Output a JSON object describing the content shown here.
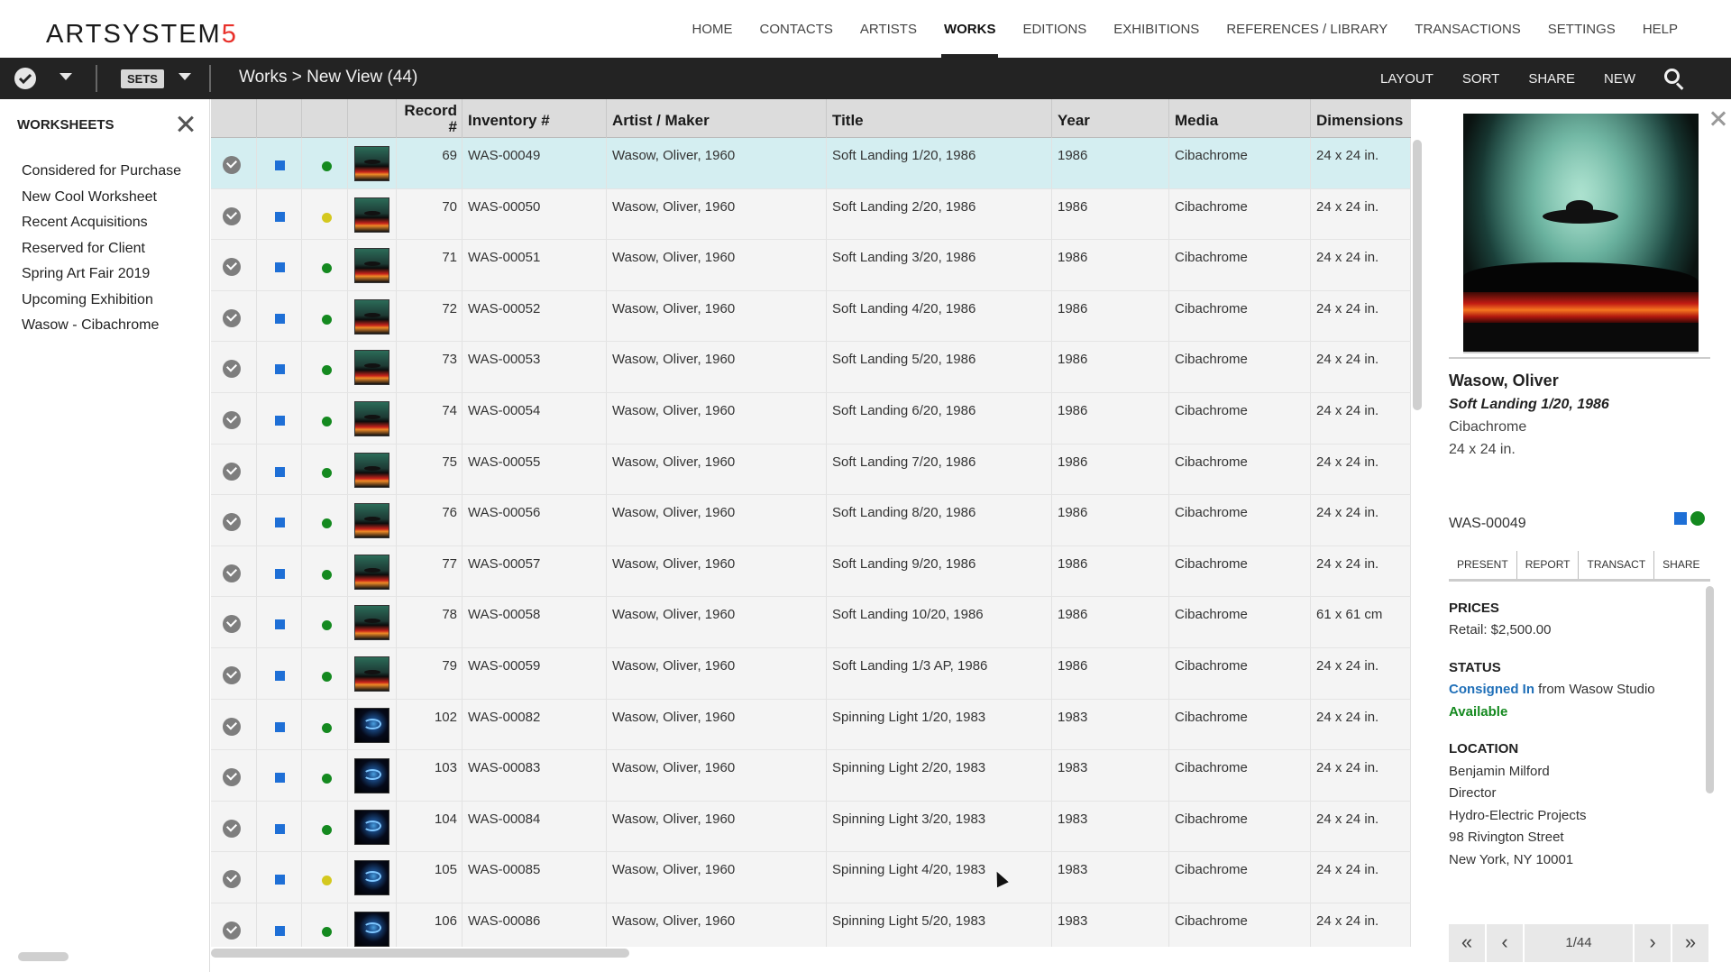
{
  "app": {
    "logo_main": "ARTSYSTEM",
    "logo_accent": "5"
  },
  "nav": [
    "HOME",
    "CONTACTS",
    "ARTISTS",
    "WORKS",
    "EDITIONS",
    "EXHIBITIONS",
    "REFERENCES / LIBRARY",
    "TRANSACTIONS",
    "SETTINGS",
    "HELP"
  ],
  "nav_active": "WORKS",
  "toolbar": {
    "sets_label": "SETS",
    "breadcrumb": "Works > New View (44)",
    "actions": [
      "LAYOUT",
      "SORT",
      "SHARE",
      "NEW"
    ]
  },
  "sidebar": {
    "title": "WORKSHEETS",
    "items": [
      "Considered for Purchase",
      "New Cool Worksheet",
      "Recent Acquisitions",
      "Reserved for Client",
      "Spring Art Fair 2019",
      "Upcoming Exhibition",
      "Wasow - Cibachrome"
    ]
  },
  "table": {
    "headers": {
      "record": "Record #",
      "inventory": "Inventory #",
      "artist": "Artist / Maker",
      "title": "Title",
      "year": "Year",
      "media": "Media",
      "dimensions": "Dimensions"
    },
    "rows": [
      {
        "record": "69",
        "inventory": "WAS-00049",
        "artist": "Wasow, Oliver, 1960",
        "title": "Soft Landing 1/20, 1986",
        "year": "1986",
        "media": "Cibachrome",
        "dimensions": "24 x 24 in.",
        "status": "green",
        "thumb": "soft",
        "selected": true
      },
      {
        "record": "70",
        "inventory": "WAS-00050",
        "artist": "Wasow, Oliver, 1960",
        "title": "Soft Landing 2/20, 1986",
        "year": "1986",
        "media": "Cibachrome",
        "dimensions": "24 x 24 in.",
        "status": "yellow",
        "thumb": "soft"
      },
      {
        "record": "71",
        "inventory": "WAS-00051",
        "artist": "Wasow, Oliver, 1960",
        "title": "Soft Landing 3/20, 1986",
        "year": "1986",
        "media": "Cibachrome",
        "dimensions": "24 x 24 in.",
        "status": "green",
        "thumb": "soft"
      },
      {
        "record": "72",
        "inventory": "WAS-00052",
        "artist": "Wasow, Oliver, 1960",
        "title": "Soft Landing 4/20, 1986",
        "year": "1986",
        "media": "Cibachrome",
        "dimensions": "24 x 24 in.",
        "status": "green",
        "thumb": "soft"
      },
      {
        "record": "73",
        "inventory": "WAS-00053",
        "artist": "Wasow, Oliver, 1960",
        "title": "Soft Landing 5/20, 1986",
        "year": "1986",
        "media": "Cibachrome",
        "dimensions": "24 x 24 in.",
        "status": "green",
        "thumb": "soft"
      },
      {
        "record": "74",
        "inventory": "WAS-00054",
        "artist": "Wasow, Oliver, 1960",
        "title": "Soft Landing 6/20, 1986",
        "year": "1986",
        "media": "Cibachrome",
        "dimensions": "24 x 24 in.",
        "status": "green",
        "thumb": "soft"
      },
      {
        "record": "75",
        "inventory": "WAS-00055",
        "artist": "Wasow, Oliver, 1960",
        "title": "Soft Landing 7/20, 1986",
        "year": "1986",
        "media": "Cibachrome",
        "dimensions": "24 x 24 in.",
        "status": "green",
        "thumb": "soft"
      },
      {
        "record": "76",
        "inventory": "WAS-00056",
        "artist": "Wasow, Oliver, 1960",
        "title": "Soft Landing 8/20, 1986",
        "year": "1986",
        "media": "Cibachrome",
        "dimensions": "24 x 24 in.",
        "status": "green",
        "thumb": "soft"
      },
      {
        "record": "77",
        "inventory": "WAS-00057",
        "artist": "Wasow, Oliver, 1960",
        "title": "Soft Landing 9/20, 1986",
        "year": "1986",
        "media": "Cibachrome",
        "dimensions": "24 x 24 in.",
        "status": "green",
        "thumb": "soft"
      },
      {
        "record": "78",
        "inventory": "WAS-00058",
        "artist": "Wasow, Oliver, 1960",
        "title": "Soft Landing 10/20, 1986",
        "year": "1986",
        "media": "Cibachrome",
        "dimensions": "61 x 61 cm",
        "status": "green",
        "thumb": "soft"
      },
      {
        "record": "79",
        "inventory": "WAS-00059",
        "artist": "Wasow, Oliver, 1960",
        "title": "Soft Landing 1/3 AP, 1986",
        "year": "1986",
        "media": "Cibachrome",
        "dimensions": "24 x 24 in.",
        "status": "green",
        "thumb": "soft"
      },
      {
        "record": "102",
        "inventory": "WAS-00082",
        "artist": "Wasow, Oliver, 1960",
        "title": "Spinning Light 1/20, 1983",
        "year": "1983",
        "media": "Cibachrome",
        "dimensions": "24 x 24 in.",
        "status": "green",
        "thumb": "spin"
      },
      {
        "record": "103",
        "inventory": "WAS-00083",
        "artist": "Wasow, Oliver, 1960",
        "title": "Spinning Light 2/20, 1983",
        "year": "1983",
        "media": "Cibachrome",
        "dimensions": "24 x 24 in.",
        "status": "green",
        "thumb": "spin"
      },
      {
        "record": "104",
        "inventory": "WAS-00084",
        "artist": "Wasow, Oliver, 1960",
        "title": "Spinning Light 3/20, 1983",
        "year": "1983",
        "media": "Cibachrome",
        "dimensions": "24 x 24 in.",
        "status": "green",
        "thumb": "spin"
      },
      {
        "record": "105",
        "inventory": "WAS-00085",
        "artist": "Wasow, Oliver, 1960",
        "title": "Spinning Light 4/20, 1983",
        "year": "1983",
        "media": "Cibachrome",
        "dimensions": "24 x 24 in.",
        "status": "yellow",
        "thumb": "spin"
      },
      {
        "record": "106",
        "inventory": "WAS-00086",
        "artist": "Wasow, Oliver, 1960",
        "title": "Spinning Light 5/20, 1983",
        "year": "1983",
        "media": "Cibachrome",
        "dimensions": "24 x 24 in.",
        "status": "green",
        "thumb": "spin"
      }
    ]
  },
  "detail": {
    "artist": "Wasow, Oliver",
    "title": "Soft Landing 1/20, 1986",
    "media": "Cibachrome",
    "dimensions": "24 x 24 in.",
    "inventory": "WAS-00049",
    "tabs": [
      "PRESENT",
      "REPORT",
      "TRANSACT",
      "SHARE"
    ],
    "prices_label": "PRICES",
    "retail": "Retail: $2,500.00",
    "status_label": "STATUS",
    "consigned": "Consigned In",
    "consigned_from": " from Wasow Studio",
    "availability": "Available",
    "location_label": "LOCATION",
    "location_lines": [
      "Benjamin Milford",
      "Director",
      "Hydro-Electric Projects",
      "98 Rivington Street",
      "New York, NY 10001"
    ],
    "pager": {
      "first": "«",
      "prev": "‹",
      "count": "1/44",
      "next": "›",
      "last": "»"
    }
  },
  "colors": {
    "status_green": "#14891f",
    "status_yellow": "#d4c81e",
    "flag_blue": "#1e6fd6",
    "selected_row": "#d4eef1"
  }
}
